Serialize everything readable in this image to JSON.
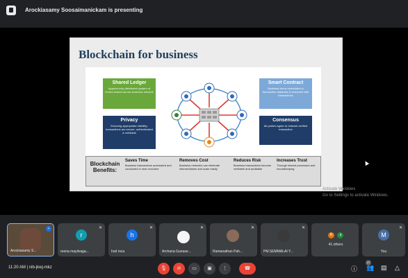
{
  "top_bar": {
    "presenting_text": "Arockiasamy Soosaimanickam is presenting"
  },
  "slide": {
    "title": "Blockchain for business",
    "boxes": {
      "shared_ledger": {
        "title": "Shared Ledger",
        "desc": "Append-only distributed system of record shared across business network"
      },
      "privacy": {
        "title": "Privacy",
        "desc": "Ensuring appropriate visibility; transactions are secure, authenticated & verifiable"
      },
      "smart_contract": {
        "title": "Smart Contract",
        "desc": "Business terms embedded in transaction database & executed with transactions"
      },
      "consensus": {
        "title": "Consensus",
        "desc": "All parties agree to network verified transaction"
      }
    },
    "benefits": {
      "label_line1": "Blockchain",
      "label_line2": "Benefits:",
      "columns": [
        {
          "heading": "Saves Time",
          "desc": "Business transactions automated and conducted in near real-time"
        },
        {
          "heading": "Removes Cost",
          "desc": "Business networks can eliminate intermediaries and scale easily"
        },
        {
          "heading": "Reduces Risk",
          "desc": "Business transactions become verifiable and auditable"
        },
        {
          "heading": "Increases Trust",
          "desc": "Through shared processes and recordkeeping"
        }
      ]
    }
  },
  "watermark": {
    "line1": "Activate Windows",
    "line2": "Go to Settings to activate Windows."
  },
  "participants": [
    {
      "name": "Arockiasamy S...",
      "initial": "",
      "color": "#5a4a3a"
    },
    {
      "name": "reena mayilvaga...",
      "initial": "r",
      "color": "#129eaf"
    },
    {
      "name": "hod mca",
      "initial": "h",
      "color": "#1a73e8"
    },
    {
      "name": "Archana Gunase...",
      "initial": "",
      "color": "#f5f5f5"
    },
    {
      "name": "Ramanathan Pah...",
      "initial": "",
      "color": "#8a6a5a"
    },
    {
      "name": "PM.SEMMALAI Y...",
      "initial": "",
      "color": "#333333"
    },
    {
      "name": "41 others",
      "initial": "",
      "color": ""
    },
    {
      "name": "You",
      "initial": "M",
      "color": "#4a6fa5"
    }
  ],
  "others_minis": [
    {
      "initial": "R",
      "color": "#e8710a"
    },
    {
      "initial": "a",
      "color": "#1e8e3e"
    }
  ],
  "bottom": {
    "meeting_info": "11:20 AM  |  nib-jkwj-mkz",
    "people_badge": "47",
    "icons": {
      "mic": "mic-off-icon",
      "cam": "camera-off-icon",
      "cc": "captions-icon",
      "present": "present-icon",
      "more": "more-options-icon",
      "end": "end-call-icon",
      "info": "info-icon",
      "people": "people-icon",
      "chat": "chat-icon",
      "activities": "activities-icon"
    }
  }
}
